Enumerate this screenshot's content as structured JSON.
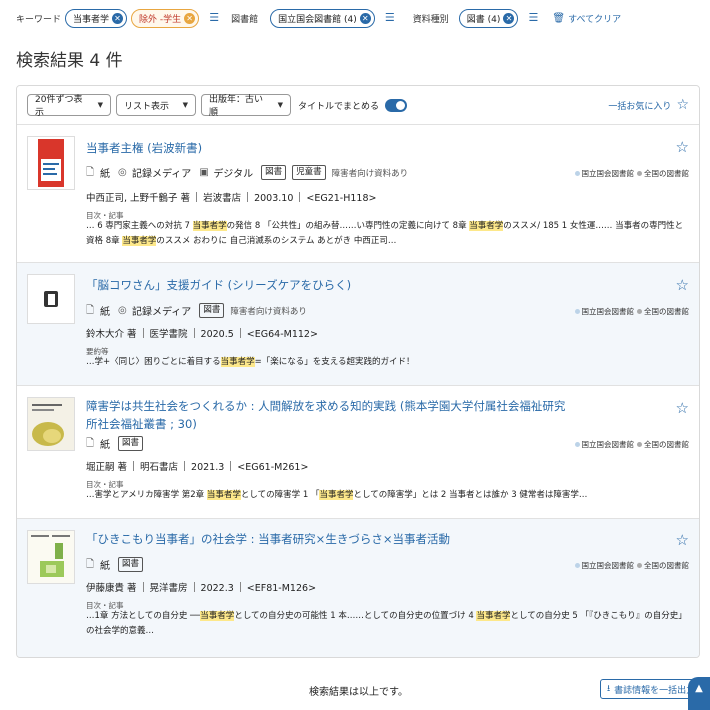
{
  "filters": {
    "keyword_label": "キーワード",
    "keyword_chip": "当事者学",
    "exclude_chip": "除外 -学生",
    "library_label": "図書館",
    "library_chip": "国立国会図書館 (4)",
    "type_label": "資料種別",
    "type_chip": "図書 (4)",
    "clear_all": "すべてクリア"
  },
  "page_title": "検索結果 4 件",
  "toolbar": {
    "per_page": "20件ずつ表示",
    "view": "リスト表示",
    "sort": "出版年：古い順",
    "group_label": "タイトルでまとめる",
    "group_on": true,
    "fav_all": "一括お気に入り"
  },
  "libs": {
    "ndl": "国立国会図書館",
    "all": "全国の図書館"
  },
  "results": [
    {
      "title": "当事者主権 (岩波新書)",
      "media": [
        "紙",
        "記録メディア",
        "デジタル"
      ],
      "tags": [
        "図書",
        "児童書"
      ],
      "note": "障害者向け資料あり",
      "authors": "中西正司, 上野千鶴子 著",
      "publisher": "岩波書店",
      "year": "2003.10",
      "call": "<EG21-H118>",
      "snippet_head": "目次・記事",
      "snippet": [
        {
          "t": "… 6 専門家主義への対抗 7 "
        },
        {
          "t": "当事者学",
          "h": true
        },
        {
          "t": "の発信 8 「公共性」の組み替……い専門性の定義に向けて 8章 "
        },
        {
          "t": "当事者学",
          "h": true
        },
        {
          "t": "のススメ/ 185 1 女性運…… 当事者の専門性と資格 8章 "
        },
        {
          "t": "当事者学",
          "h": true
        },
        {
          "t": "のススメ おわりに 自己消滅系のシステム あとがき 中西正司…"
        }
      ]
    },
    {
      "title": "「脳コワさん」支援ガイド (シリーズケアをひらく)",
      "media": [
        "紙",
        "記録メディア"
      ],
      "tags": [
        "図書"
      ],
      "note": "障害者向け資料あり",
      "authors": "鈴木大介 著",
      "publisher": "医学書院",
      "year": "2020.5",
      "call": "<EG64-M112>",
      "snippet_head": "要約等",
      "snippet": [
        {
          "t": "…学+〈同じ〉困りごとに着目する"
        },
        {
          "t": "当事者学",
          "h": true
        },
        {
          "t": "=「楽になる」を支える超実践的ガイド！"
        }
      ]
    },
    {
      "title": "障害学は共生社会をつくれるか : 人間解放を求める知的実践 (熊本学園大学付属社会福祉研究所社会福祉叢書 ; 30)",
      "media": [
        "紙"
      ],
      "tags": [
        "図書"
      ],
      "note": "",
      "authors": "堀正嗣 著",
      "publisher": "明石書店",
      "year": "2021.3",
      "call": "<EG61-M261>",
      "snippet_head": "目次・記事",
      "snippet": [
        {
          "t": "…害学とアメリカ障害学 第2章 "
        },
        {
          "t": "当事者学",
          "h": true
        },
        {
          "t": "としての障害学 1 「"
        },
        {
          "t": "当事者学",
          "h": true
        },
        {
          "t": "としての障害学」とは 2 当事者とは誰か 3 健常者は障害学…"
        }
      ]
    },
    {
      "title": "「ひきこもり当事者」の社会学 : 当事者研究×生きづらさ×当事者活動",
      "media": [
        "紙"
      ],
      "tags": [
        "図書"
      ],
      "note": "",
      "authors": "伊藤康貴 著",
      "publisher": "晃洋書房",
      "year": "2022.3",
      "call": "<EF81-M126>",
      "snippet_head": "目次・記事",
      "snippet": [
        {
          "t": "…1章 方法としての自分史 ──"
        },
        {
          "t": "当事者学",
          "h": true
        },
        {
          "t": "としての自分史の可能性 1 本……としての自分史の位置づけ 4 "
        },
        {
          "t": "当事者学",
          "h": true
        },
        {
          "t": "としての自分史 5 「『ひきこもり』の自分史」の社会学的意義…"
        }
      ]
    }
  ],
  "footer": {
    "end_text": "検索結果は以上です。",
    "export": "書誌情報を一括出力"
  },
  "colors": {
    "accent": "#2a6aa8",
    "highlight": "#fde88a",
    "exclude": "#e8a640"
  }
}
